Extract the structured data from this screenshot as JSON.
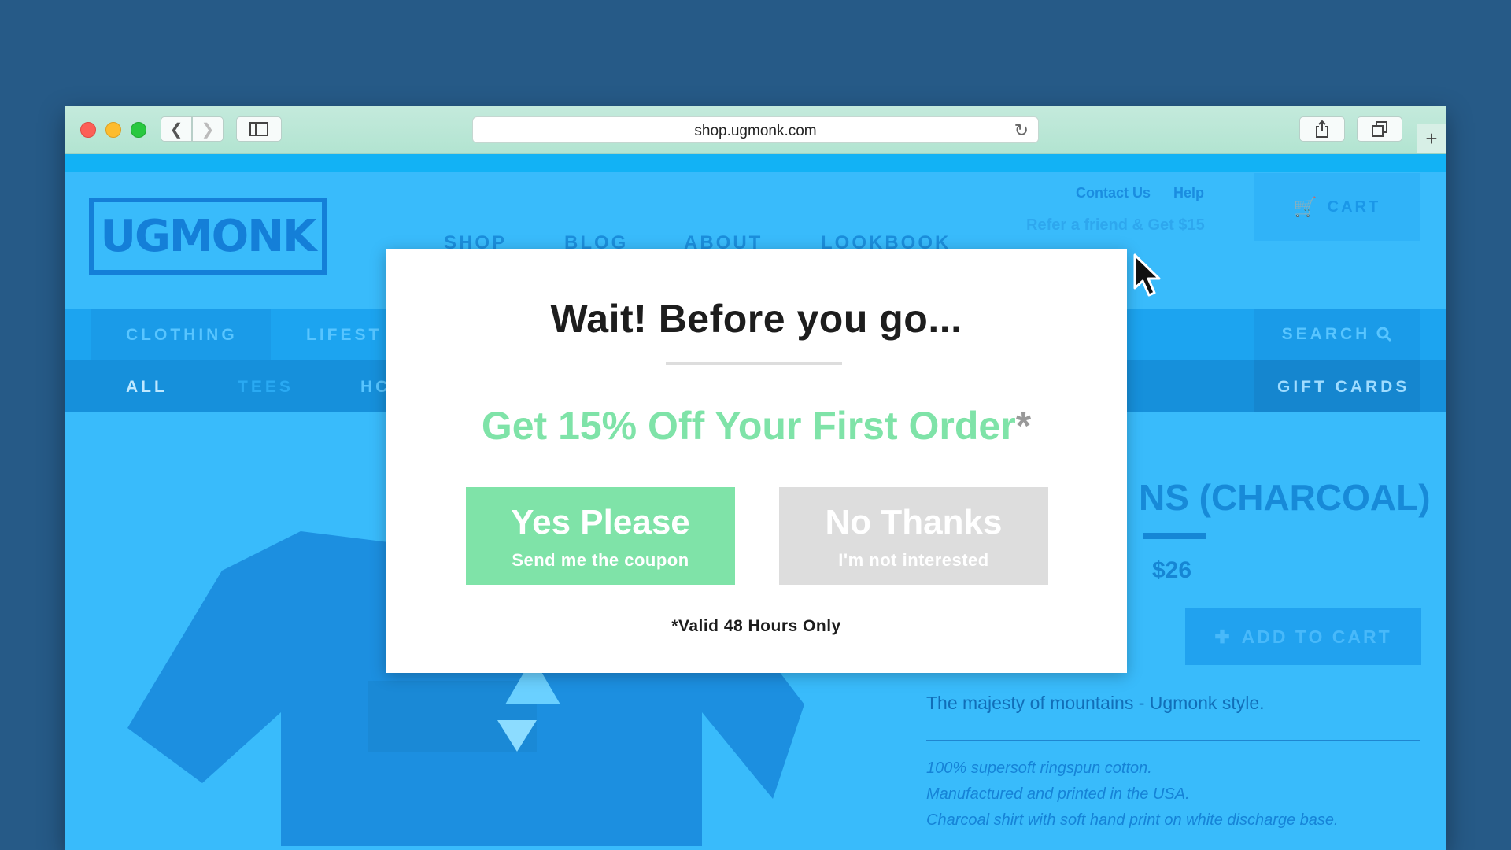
{
  "browser": {
    "url": "shop.ugmonk.com",
    "new_tab_label": "+"
  },
  "site": {
    "logo_text": "UGMONK",
    "main_nav": [
      "SHOP",
      "BLOG",
      "ABOUT",
      "LOOKBOOK"
    ],
    "util_links": {
      "contact": "Contact Us",
      "help": "Help"
    },
    "refer": "Refer a friend & Get $15",
    "cart_label": "CART",
    "categories": [
      "CLOTHING",
      "LIFEST"
    ],
    "search_label": "SEARCH",
    "subcategories": [
      "ALL",
      "TEES",
      "HC"
    ],
    "gift_cards": "GIFT CARDS",
    "product": {
      "title_fragment": "NS (CHARCOAL)",
      "price": "$26",
      "add_to_cart": "ADD TO CART",
      "description": "The majesty of mountains - Ugmonk style.",
      "details": [
        "100% supersoft ringspun cotton.",
        "Manufactured and printed in the USA.",
        "Charcoal shirt with soft hand print on white discharge base."
      ]
    }
  },
  "modal": {
    "title": "Wait! Before you go...",
    "offer": "Get 15% Off Your First Order",
    "offer_star": "*",
    "yes": {
      "main": "Yes Please",
      "sub": "Send me the coupon"
    },
    "no": {
      "main": "No Thanks",
      "sub": "I'm not interested"
    },
    "note": "*Valid 48 Hours Only"
  },
  "colors": {
    "desktop": "#265a87",
    "site_background": "#39bbfb",
    "offer_green": "#7fe3a8",
    "no_gray": "#dddddd"
  }
}
